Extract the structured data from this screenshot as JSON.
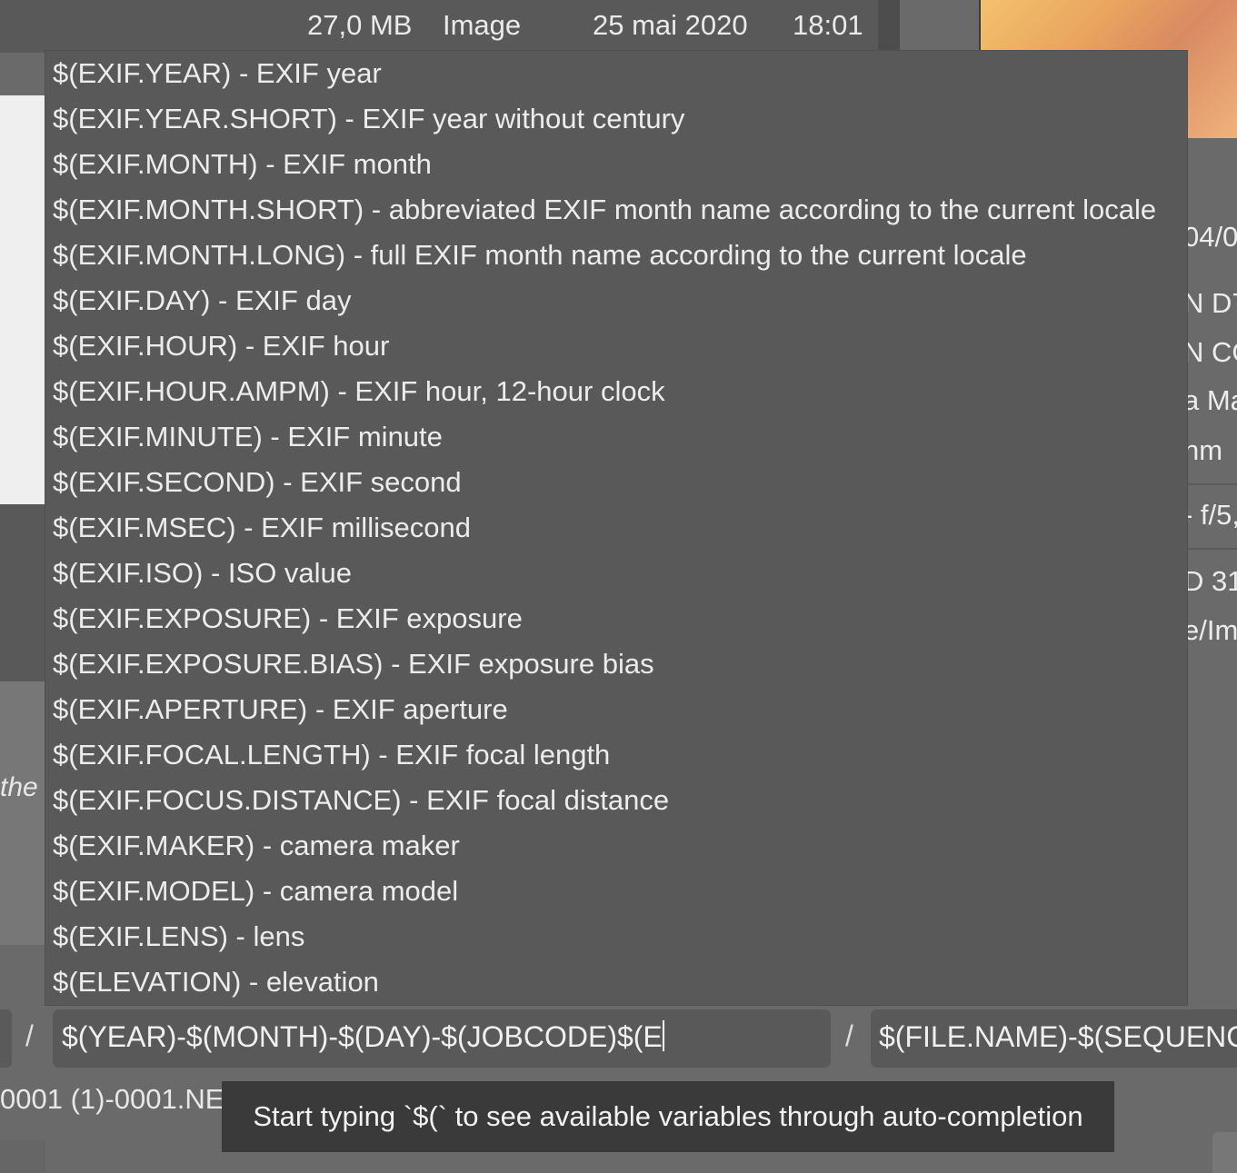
{
  "file_row": {
    "size": "27,0 MB",
    "type": "Image",
    "date": "25 mai 2020",
    "time": "18:01"
  },
  "left_fragment": "the",
  "right_metadata": [
    "04/0",
    "N D7",
    "N CO",
    "a Ma",
    "nm",
    "- f/5,",
    "D 31",
    "e/Im"
  ],
  "autocomplete": {
    "items": [
      "$(EXIF.YEAR) - EXIF year",
      "$(EXIF.YEAR.SHORT) - EXIF year without century",
      "$(EXIF.MONTH) - EXIF month",
      "$(EXIF.MONTH.SHORT) - abbreviated EXIF month name according to the current locale",
      "$(EXIF.MONTH.LONG) - full EXIF month name according to the current locale",
      "$(EXIF.DAY) - EXIF day",
      "$(EXIF.HOUR) - EXIF hour",
      "$(EXIF.HOUR.AMPM) - EXIF hour, 12-hour clock",
      "$(EXIF.MINUTE) - EXIF minute",
      "$(EXIF.SECOND) - EXIF second",
      "$(EXIF.MSEC) - EXIF millisecond",
      "$(EXIF.ISO) - ISO value",
      "$(EXIF.EXPOSURE) - EXIF exposure",
      "$(EXIF.EXPOSURE.BIAS) - EXIF exposure bias",
      "$(EXIF.APERTURE) - EXIF aperture",
      "$(EXIF.FOCAL.LENGTH) - EXIF focal length",
      "$(EXIF.FOCUS.DISTANCE) - EXIF focal distance",
      "$(EXIF.MAKER) - camera maker",
      "$(EXIF.MODEL) - camera model",
      "$(EXIF.LENS) - lens",
      "$(ELEVATION) - elevation"
    ]
  },
  "pattern": {
    "separator": "/",
    "subfolder_value": "$(YEAR)-$(MONTH)-$(DAY)-$(JOBCODE)$(E",
    "filename_value": "$(FILE.NAME)-$(SEQUENCE)"
  },
  "preview_name": "0001 (1)-0001.NE",
  "tooltip": "Start typing `$(` to see available variables through auto-completion"
}
